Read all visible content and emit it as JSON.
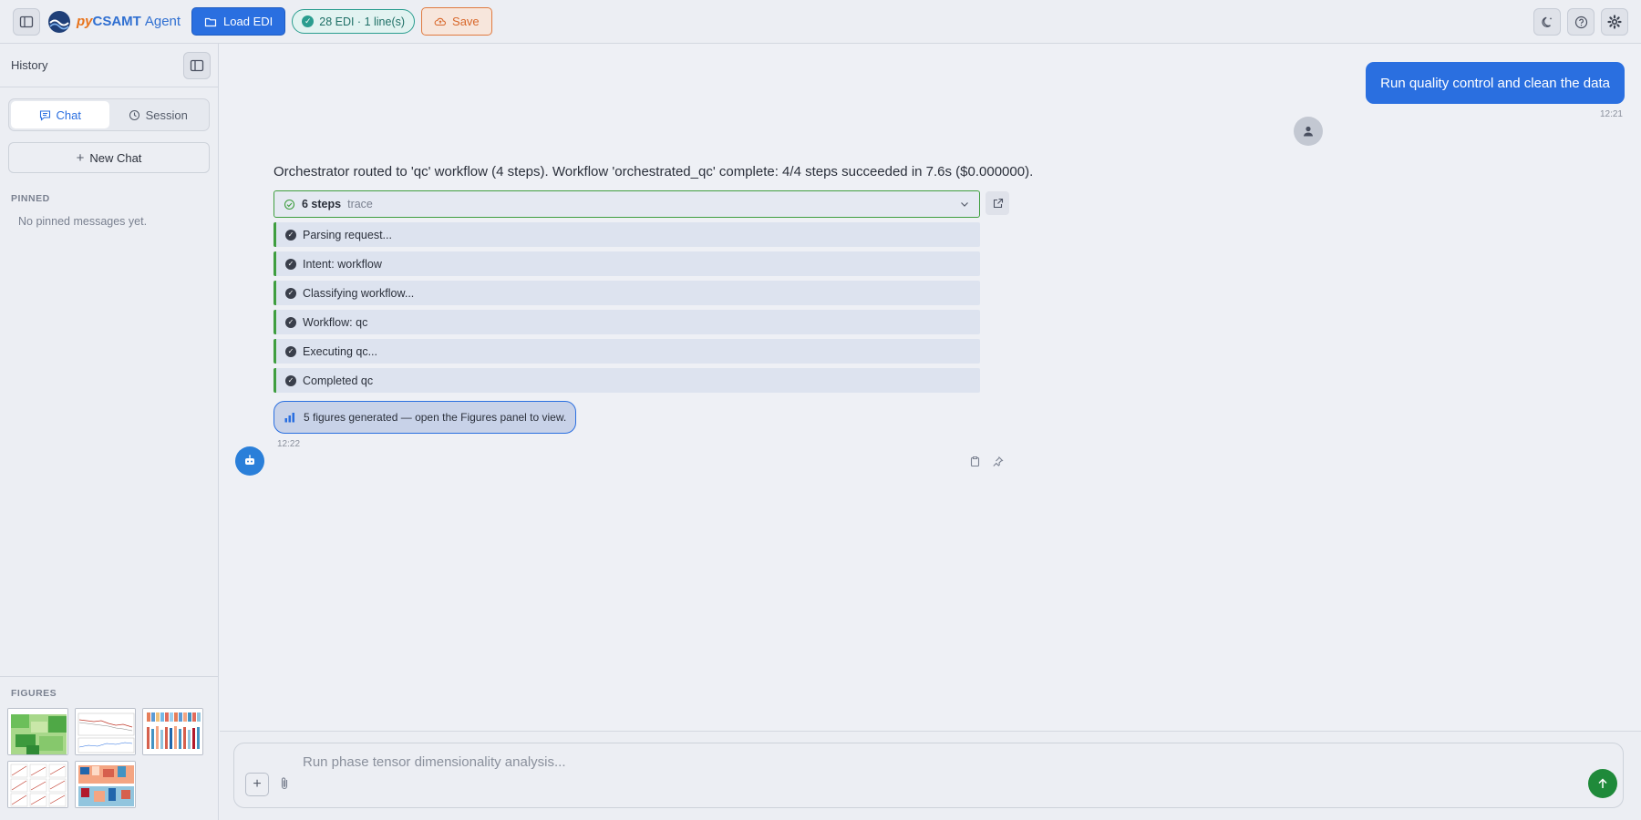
{
  "topbar": {
    "brand_py": "py",
    "brand_name": "CSAMT",
    "brand_agent": "Agent",
    "load_label": "Load EDI",
    "status_label": "28 EDI · 1 line(s)",
    "save_label": "Save"
  },
  "sidebar": {
    "title": "History",
    "tabs": [
      {
        "label": "Chat",
        "active": true
      },
      {
        "label": "Session",
        "active": false
      }
    ],
    "new_chat_label": "New Chat",
    "pinned_label": "PINNED",
    "pinned_empty": "No pinned messages yet.",
    "figures_label": "FIGURES",
    "figure_count": 5
  },
  "chat": {
    "user_message": "Run quality control and clean the data",
    "user_time": "12:21",
    "assistant_message": "Orchestrator routed to 'qc' workflow (4 steps). Workflow 'orchestrated_qc' complete: 4/4 steps succeeded in 7.6s ($0.000000).",
    "trace_count": "6 steps",
    "trace_word": "trace",
    "steps": [
      "Parsing request...",
      "Intent: workflow",
      "Classifying workflow...",
      "Workflow: qc",
      "Executing qc...",
      "Completed qc"
    ],
    "figures_note": "5 figures generated — open the Figures panel to view.",
    "assistant_time": "12:22"
  },
  "composer": {
    "placeholder": "Run phase tensor dimensionality analysis..."
  },
  "colors": {
    "accent": "#2a6fe0",
    "success": "#3f9e3f",
    "save": "#d8672a",
    "status": "#2a9d8f",
    "send": "#1f8a3a"
  }
}
